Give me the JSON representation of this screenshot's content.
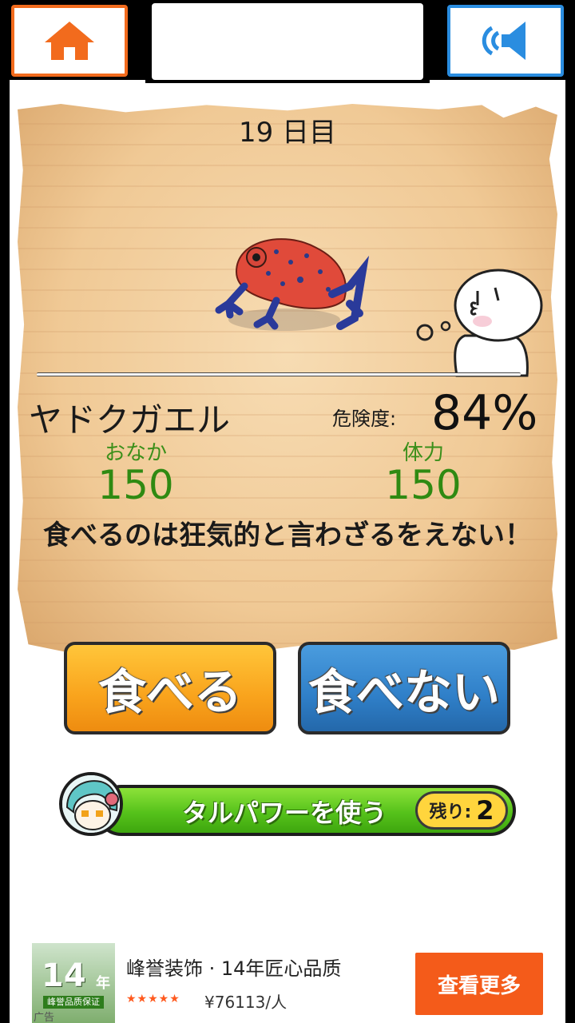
{
  "top_bar": {
    "home_icon": "home-icon",
    "sound_icon": "speaker-icon"
  },
  "card": {
    "day_label": "19 日目",
    "animal_name": "ヤドクガエル",
    "danger_label": "危険度:",
    "danger_value": "84%",
    "danger_level": 0.84,
    "stats": [
      {
        "label": "おなか",
        "value": "150"
      },
      {
        "label": "体力",
        "value": "150"
      }
    ],
    "message": "食べるのは狂気的と言わざるをえない！"
  },
  "actions": {
    "eat_label": "食べる",
    "dont_eat_label": "食べない"
  },
  "power": {
    "label": "タルパワーを使う",
    "remaining_label": "残り:",
    "remaining_value": "2"
  },
  "ad": {
    "image_years": "14",
    "image_years_unit": "年",
    "image_badge": "峰誉品质保证",
    "ad_tag": "广告",
    "title": "峰誉装饰 · 14年匠心品质",
    "rating_stars": "★★★★★",
    "price": "¥76113/人",
    "cta_label": "查看更多"
  },
  "colors": {
    "home_border": "#f26b1d",
    "sound_border": "#2a8de0",
    "eat_button": "#f9a31c",
    "dont_eat_button": "#2f7fc8",
    "power_bar": "#56c21b",
    "stat_green": "#2f8a12",
    "ad_cta": "#f45b1a"
  }
}
